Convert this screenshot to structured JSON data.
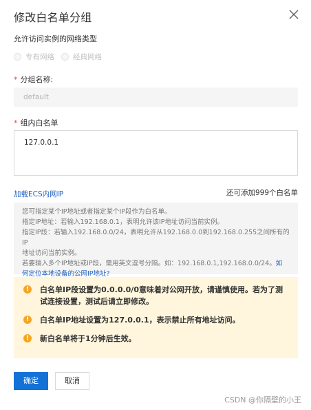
{
  "dialog": {
    "title": "修改白名单分组",
    "network_label": "允许访问实例的网络类型",
    "network_options": [
      "专有网络",
      "经典网络"
    ],
    "group_name_label": "分组名称:",
    "group_name_value": "default",
    "whitelist_label": "组内白名单",
    "whitelist_value": "127.0.0.1",
    "load_ecs_link": "加载ECS内网IP",
    "remaining_count": "还可添加999个白名单",
    "help_lines": [
      "您可指定某个IP地址或者指定某个IP段作为白名单。",
      "指定IP地址：若输入192.168.0.1，表明允许该IP地址访问当前实例。",
      "指定IP段：若输入192.168.0.0/24，表明允许从192.168.0.0到192.168.0.255之间所有的IP",
      "地址访问当前实例。",
      "若要输入多个IP地址或IP段，需用英文逗号分隔。如：192.168.0.1,192.168.0.0/24。"
    ],
    "help_link_part1": "如",
    "help_link_part2": "何定位本地设备的公网IP地址?",
    "warnings": [
      "白名单IP段设置为0.0.0.0/0意味着对公网开放，请谨慎使用。若为了测试连接设置，测试后请立即修改。",
      "白名单IP地址设置为127.0.0.1，表示禁止所有地址访问。",
      "新白名单将于1分钟后生效。"
    ],
    "warning_icon": "!",
    "ok_label": "确定",
    "cancel_label": "取消",
    "watermark": "CSDN @你隔壁的小王"
  }
}
